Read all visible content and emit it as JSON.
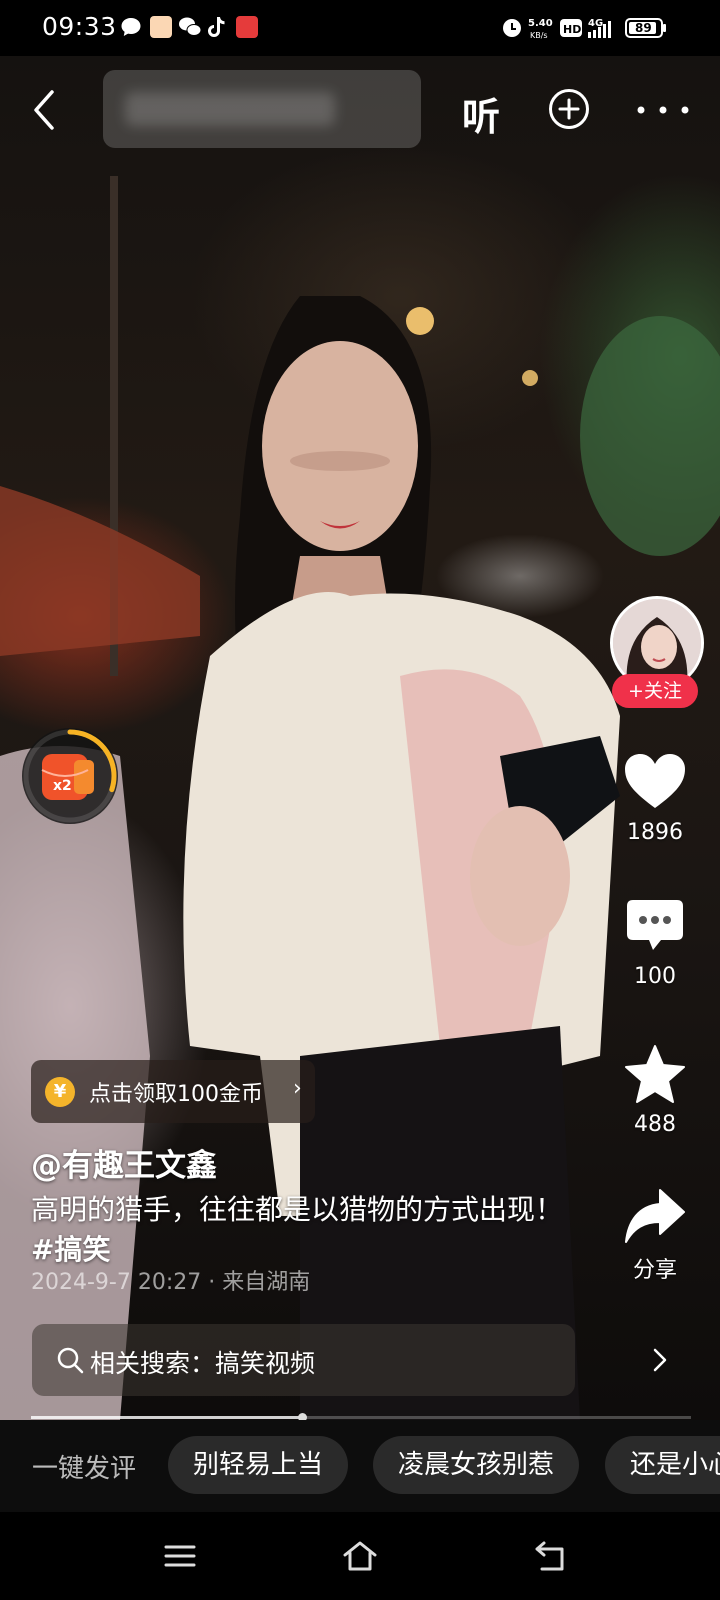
{
  "status_bar": {
    "time": "09:33",
    "network_speed": "5.40",
    "network_speed_unit": "KB/s",
    "hd_badge": "HD",
    "signal_type": "4G",
    "battery": "89"
  },
  "top_bar": {
    "listen_label": "听"
  },
  "author": {
    "handle": "@有趣王文鑫",
    "follow_label": "+关注"
  },
  "actions": {
    "likes": "1896",
    "comments": "100",
    "favorites": "488",
    "share_label": "分享"
  },
  "coin_widget": {
    "multiplier": "x2",
    "progress": 0.3
  },
  "reward_chip": {
    "coin_glyph": "¥",
    "label": "点击领取100金币",
    "chevron": "›"
  },
  "caption": {
    "text": "高明的猎手，往往都是以猎物的方式出现！ ",
    "hashtag": "#搞笑"
  },
  "post_meta": "2024-9-7 20:27  ·  来自湖南",
  "related_search": {
    "label": "相关搜索：搞笑视频"
  },
  "playback": {
    "progress": 0.41
  },
  "comment_bar": {
    "label": "一键发评",
    "chips": [
      "别轻易上当",
      "凌晨女孩别惹",
      "还是小心"
    ]
  },
  "icons": [
    "back-icon",
    "plus-circle-icon",
    "more-icon",
    "heart-icon",
    "comment-icon",
    "star-icon",
    "share-icon",
    "search-icon",
    "chevron-right-icon",
    "menu-icon",
    "home-icon",
    "back-nav-icon"
  ],
  "colors": {
    "follow_red": "#f0314a",
    "coin_gold": "#f4b42b",
    "envelope_orange": "#f0532a"
  }
}
